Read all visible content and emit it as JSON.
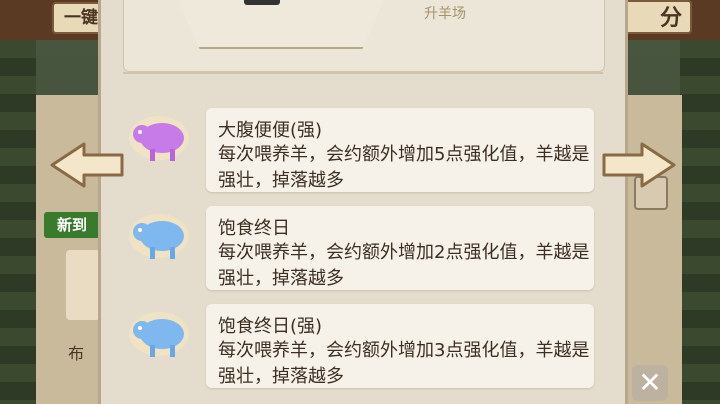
{
  "background": {
    "left_top_button": "一键",
    "right_top_button": "分",
    "new_arrival_badge": "新到",
    "left_bottom_label": "布",
    "close_icon": "close-icon"
  },
  "panel": {
    "subtitle": "升羊场"
  },
  "skills": [
    {
      "name": "大腹便便(强)",
      "desc": "每次喂养羊，会约额外增加5点强化值，羊越是强壮，掉落越多",
      "icon": "sheep-icon",
      "color": "#c77be8"
    },
    {
      "name": "饱食终日",
      "desc": "每次喂养羊，会约额外增加2点强化值，羊越是强壮，掉落越多",
      "icon": "sheep-icon",
      "color": "#7fb7ef"
    },
    {
      "name": "饱食终日(强)",
      "desc": "每次喂养羊，会约额外增加3点强化值，羊越是强壮，掉落越多",
      "icon": "sheep-icon",
      "color": "#7fb7ef"
    }
  ],
  "colors": {
    "panel_bg": "#e4dccc",
    "card_bg": "#f6f2ea",
    "text": "#3d2f22"
  }
}
